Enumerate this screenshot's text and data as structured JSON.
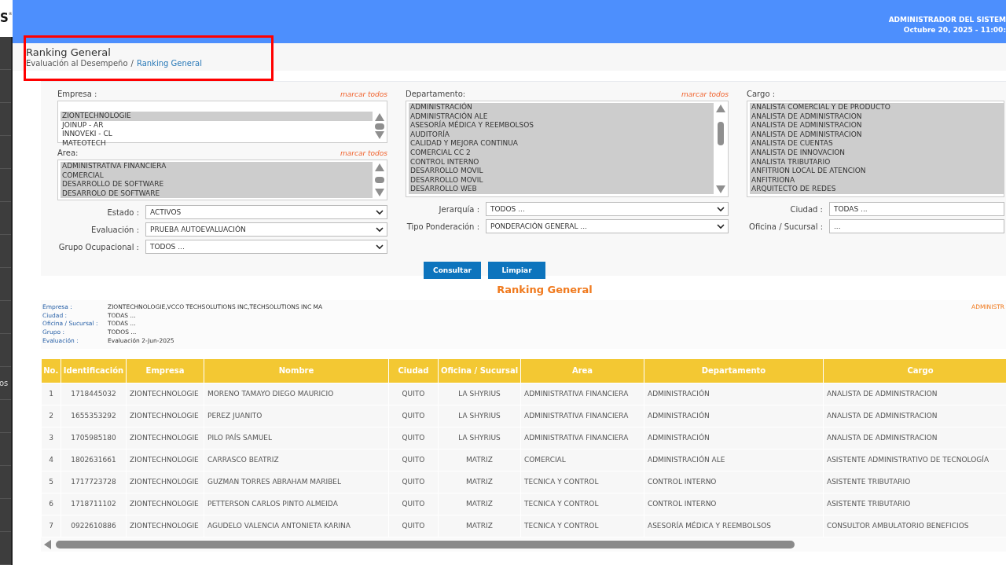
{
  "logo": {
    "letter": "S",
    "mark": "®"
  },
  "sidebar": {
    "label": "os"
  },
  "topbar": {
    "user": "ADMINISTRADOR DEL SISTEM",
    "datetime": "Octubre 20, 2025 -  11:00:"
  },
  "page_header": {
    "title": "Ranking General",
    "breadcrumb": [
      {
        "label": "Evaluación al Desempeño",
        "link": false
      },
      {
        "label": "/",
        "link": false
      },
      {
        "label": "Ranking General",
        "link": true
      }
    ]
  },
  "annotation": {
    "kind": "highlight"
  },
  "filters": {
    "lists": [
      {
        "label": "Empresa :",
        "action": "marcar todos",
        "kind": "full",
        "items": [
          {
            "label": "ZIONTECHNOLOGIE",
            "selected": true
          },
          {
            "label": "JOINUP - AR",
            "selected": false
          },
          {
            "label": "INNOVEKI - CL",
            "selected": false
          },
          {
            "label": "MATEOTECH",
            "selected": false
          }
        ]
      },
      {
        "label": "Departamento:",
        "action": "marcar todos",
        "kind": "bar",
        "items": [
          {
            "label": "ADMINISTRACIÓN",
            "selected": true
          },
          {
            "label": "ADMINISTRACIÓN ALE",
            "selected": true
          },
          {
            "label": "ASESORÍA MÉDICA Y REEMBOLSOS",
            "selected": true
          },
          {
            "label": "AUDITORÍA",
            "selected": true
          },
          {
            "label": "CALIDAD Y MEJORA CONTINUA",
            "selected": true
          },
          {
            "label": "COMERCIAL CC 2",
            "selected": true
          },
          {
            "label": "CONTROL INTERNO",
            "selected": true
          },
          {
            "label": "DESARROLLO MOVIL",
            "selected": true
          },
          {
            "label": "DESARROLLO MOVIL",
            "selected": true
          },
          {
            "label": "DESARROLLO WEB",
            "selected": true
          }
        ]
      },
      {
        "label": "Cargo :",
        "kind": "plain",
        "items": [
          {
            "label": "ANALISTA COMERCIAL Y DE PRODUCTO",
            "selected": true
          },
          {
            "label": "ANALISTA DE ADMINISTRACION",
            "selected": true
          },
          {
            "label": "ANALISTA DE ADMINISTRACION",
            "selected": true
          },
          {
            "label": "ANALISTA DE ADMINISTRACION",
            "selected": true
          },
          {
            "label": "ANALISTA DE CUENTAS",
            "selected": true
          },
          {
            "label": "ANALISTA DE INNOVACION",
            "selected": true
          },
          {
            "label": "ANALISTA TRIBUTARIO",
            "selected": true
          },
          {
            "label": "ANFITRION LOCAL DE ATENCION",
            "selected": true
          },
          {
            "label": "ANFITRIONA",
            "selected": true
          },
          {
            "label": "ARQUITECTO DE REDES",
            "selected": true
          }
        ]
      },
      {
        "label": "Area:",
        "action": "marcar todos",
        "kind": "full",
        "items": [
          {
            "label": "ADMINISTRATIVA FINANCIERA",
            "selected": true
          },
          {
            "label": "COMERCIAL",
            "selected": true
          },
          {
            "label": "DESARROLLO DE SOFTWARE",
            "selected": true
          },
          {
            "label": "DESARROLO DE SOFTWARE",
            "selected": true
          }
        ]
      }
    ],
    "selects": [
      [
        {
          "label": "Estado :",
          "value": "ACTIVOS",
          "chevron": true
        },
        {
          "label": "Evaluación :",
          "value": "PRUEBA AUTOEVALUACIÓN",
          "chevron": true
        },
        {
          "label": "Grupo Ocupacional :",
          "value": "TODOS ...",
          "chevron": true
        }
      ],
      [
        {
          "label": "Jerarquía :",
          "value": "TODOS ...",
          "chevron": true
        },
        {
          "label": "Tipo Ponderación :",
          "value": "PONDERACIÓN GENERAL ...",
          "chevron": true
        }
      ],
      [
        {
          "label": "Ciudad :",
          "value": "TODAS ...",
          "chevron": false
        },
        {
          "label": "Oficina / Sucursal :",
          "value": "...",
          "chevron": false
        }
      ]
    ],
    "buttons": [
      "Consultar",
      "Limpiar"
    ]
  },
  "report": {
    "title": "Ranking General",
    "info": [
      {
        "label": "Empresa :",
        "value": "ZIONTECHNOLOGIE,VCCO TECHSOLUTIONS INC,TECHSOLUTIONS INC MA"
      },
      {
        "label": "Ciudad :",
        "value": "TODAS ..."
      },
      {
        "label": "Oficina / Sucursal :",
        "value": "TODAS ..."
      },
      {
        "label": "Grupo :",
        "value": "TODOS ..."
      },
      {
        "label": "Evaluación :",
        "value": "Evaluación 2-Jun-2025"
      }
    ],
    "side_note": "ADMINISTR"
  },
  "table": {
    "columns": [
      "No.",
      "Identificación",
      "Empresa",
      "Nombre",
      "Ciudad",
      "Oficina / Sucursal",
      "Area",
      "Departamento",
      "Cargo"
    ],
    "rows": [
      [
        "1",
        "1718445032",
        "ZIONTECHNOLOGIE",
        "MORENO TAMAYO DIEGO MAURICIO",
        "QUITO",
        "LA SHYRIUS",
        "ADMINISTRATIVA FINANCIERA",
        "ADMINISTRACIÓN",
        "ANALISTA DE ADMINISTRACION"
      ],
      [
        "2",
        "1655353292",
        "ZIONTECHNOLOGIE",
        "PEREZ JUANITO",
        "QUITO",
        "LA SHYRIUS",
        "ADMINISTRATIVA FINANCIERA",
        "ADMINISTRACIÓN",
        "ANALISTA DE ADMINISTRACION"
      ],
      [
        "3",
        "1705985180",
        "ZIONTECHNOLOGIE",
        "PILO PAÍS SAMUEL",
        "QUITO",
        "LA SHYRIUS",
        "ADMINISTRATIVA FINANCIERA",
        "ADMINISTRACIÓN",
        "ANALISTA DE ADMINISTRACION"
      ],
      [
        "4",
        "1802631661",
        "ZIONTECHNOLOGIE",
        "CARRASCO BEATRIZ",
        "QUITO",
        "MATRIZ",
        "COMERCIAL",
        "ADMINISTRACIÓN ALE",
        "ASISTENTE ADMINISTRATIVO DE TECNOLOGÍA"
      ],
      [
        "5",
        "1717723728",
        "ZIONTECHNOLOGIE",
        "GUZMAN TORRES ABRAHAM MARIBEL",
        "QUITO",
        "MATRIZ",
        "TECNICA Y CONTROL",
        "CONTROL INTERNO",
        "ASISTENTE TRIBUTARIO"
      ],
      [
        "6",
        "1718711102",
        "ZIONTECHNOLOGIE",
        "PETTERSON CARLOS PINTO ALMEIDA",
        "QUITO",
        "MATRIZ",
        "TECNICA Y CONTROL",
        "CONTROL INTERNO",
        "ASISTENTE TRIBUTARIO"
      ],
      [
        "7",
        "0922610886",
        "ZIONTECHNOLOGIE",
        "AGUDELO VALENCIA ANTONIETA KARINA",
        "QUITO",
        "MATRIZ",
        "TECNICA Y CONTROL",
        "ASESORÍA MÉDICA Y REEMBOLSOS",
        "CONSULTOR AMBULATORIO BENEFICIOS"
      ]
    ]
  }
}
